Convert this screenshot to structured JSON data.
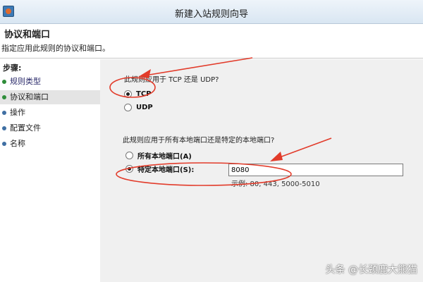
{
  "window": {
    "title": "新建入站规则向导"
  },
  "header": {
    "title": "协议和端口",
    "description": "指定应用此规则的协议和端口。"
  },
  "sidebar": {
    "heading": "步骤:",
    "items": [
      {
        "label": "规则类型",
        "state": "done"
      },
      {
        "label": "协议和端口",
        "state": "active"
      },
      {
        "label": "操作",
        "state": "pending"
      },
      {
        "label": "配置文件",
        "state": "pending"
      },
      {
        "label": "名称",
        "state": "pending"
      }
    ]
  },
  "protocol": {
    "question": "此规则应用于 TCP 还是 UDP?",
    "options": [
      {
        "label": "TCP",
        "checked": true
      },
      {
        "label": "UDP",
        "checked": false
      }
    ]
  },
  "ports": {
    "question": "此规则应用于所有本地端口还是特定的本地端口?",
    "options": [
      {
        "label": "所有本地端口(A)",
        "checked": false
      },
      {
        "label": "特定本地端口(S):",
        "checked": true
      }
    ],
    "input_value": "8080",
    "example": "示例: 80, 443, 5000-5010"
  },
  "annotation_color": "#e23b2a",
  "watermark": "头条 @长颈鹿大熊猫"
}
